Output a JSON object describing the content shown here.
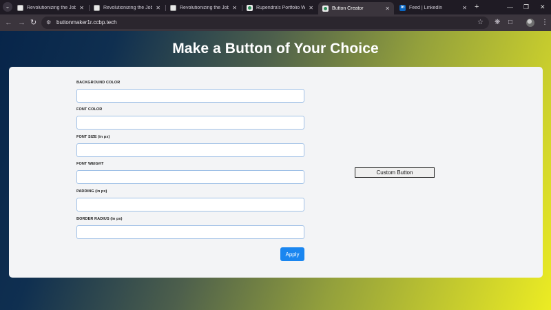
{
  "browser": {
    "tabs": [
      {
        "title": "Revolutionizing the Job M",
        "favicon": "doc-favicon",
        "active": false
      },
      {
        "title": "Revolutionizing the Job M",
        "favicon": "doc-favicon",
        "active": false
      },
      {
        "title": "Revolutionizing the Job M",
        "favicon": "doc-favicon",
        "active": false
      },
      {
        "title": "Rupendra's Portfolio Web",
        "favicon": "ccbp-favicon",
        "active": false
      },
      {
        "title": "Button Creator",
        "favicon": "ccbp-favicon",
        "active": true
      },
      {
        "title": "Feed | LinkedIn",
        "favicon": "linkedin-favicon",
        "active": false
      }
    ],
    "url": "buttonmaker1r.ccbp.tech",
    "window_controls": [
      "minimize",
      "restore",
      "close"
    ]
  },
  "page": {
    "heading": "Make a Button of Your Choice",
    "colors": {
      "gradient_start": "#07254a",
      "gradient_end": "#ecec23",
      "apply_button": "#1a86f0"
    },
    "form": {
      "fields": [
        {
          "label": "BACKGROUND COLOR",
          "value": ""
        },
        {
          "label": "FONT COLOR",
          "value": ""
        },
        {
          "label": "FONT SIZE (in px)",
          "value": ""
        },
        {
          "label": "FONT WEIGHT",
          "value": ""
        },
        {
          "label": "PADDING (in px)",
          "value": ""
        },
        {
          "label": "BORDER RADIUS (in px)",
          "value": ""
        }
      ],
      "apply_label": "Apply"
    },
    "preview": {
      "button_label": "Custom Button"
    }
  }
}
